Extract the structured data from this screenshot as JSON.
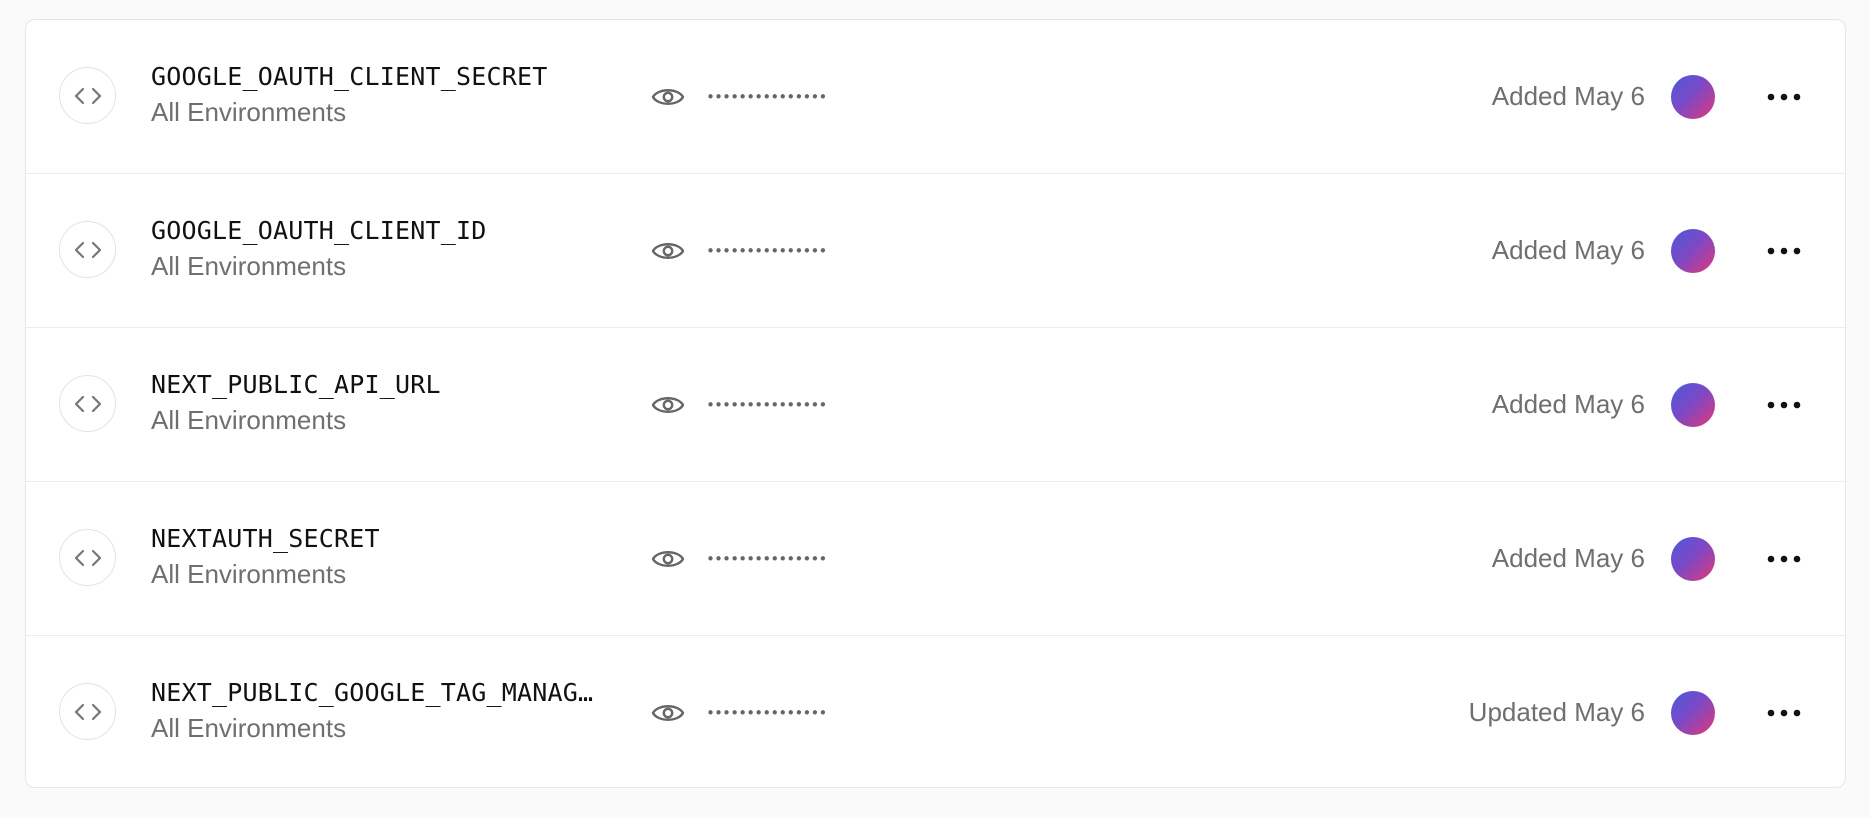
{
  "env_vars": [
    {
      "name": "GOOGLE_OAUTH_CLIENT_SECRET",
      "environment": "All Environments",
      "masked_value": "•••••••••••••••",
      "date": "Added May 6"
    },
    {
      "name": "GOOGLE_OAUTH_CLIENT_ID",
      "environment": "All Environments",
      "masked_value": "•••••••••••••••",
      "date": "Added May 6"
    },
    {
      "name": "NEXT_PUBLIC_API_URL",
      "environment": "All Environments",
      "masked_value": "•••••••••••••••",
      "date": "Added May 6"
    },
    {
      "name": "NEXTAUTH_SECRET",
      "environment": "All Environments",
      "masked_value": "•••••••••••••••",
      "date": "Added May 6"
    },
    {
      "name": "NEXT_PUBLIC_GOOGLE_TAG_MANAG…",
      "environment": "All Environments",
      "masked_value": "•••••••••••••••",
      "date": "Updated May 6"
    }
  ],
  "icons": {
    "row_icon": "code-icon",
    "reveal": "eye-icon",
    "menu": "more-horizontal-icon"
  },
  "colors": {
    "avatar_gradient": [
      "#4b5bdc",
      "#7a49c6",
      "#e0387a"
    ],
    "muted_text": "#6f6f6f"
  }
}
